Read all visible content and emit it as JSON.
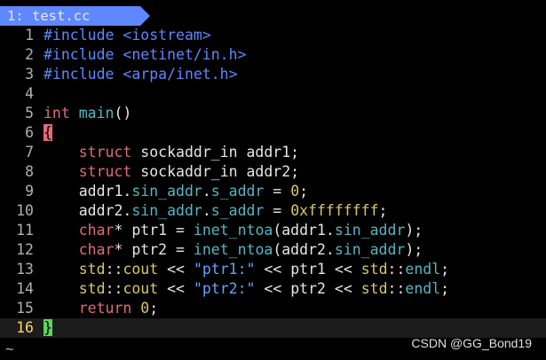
{
  "tab": {
    "label": "1: test.cc"
  },
  "lines": [
    {
      "num": "1",
      "code": [
        {
          "t": "#include ",
          "c": "pp"
        },
        {
          "t": "<iostream>",
          "c": "pp"
        }
      ]
    },
    {
      "num": "2",
      "code": [
        {
          "t": "#include ",
          "c": "pp"
        },
        {
          "t": "<netinet/in.h>",
          "c": "pp"
        }
      ]
    },
    {
      "num": "3",
      "code": [
        {
          "t": "#include ",
          "c": "pp"
        },
        {
          "t": "<arpa/inet.h>",
          "c": "pp"
        }
      ]
    },
    {
      "num": "4",
      "code": []
    },
    {
      "num": "5",
      "code": [
        {
          "t": "int",
          "c": "ty"
        },
        {
          "t": " ",
          "c": "plain"
        },
        {
          "t": "main",
          "c": "fn"
        },
        {
          "t": "()",
          "c": "plain"
        }
      ]
    },
    {
      "num": "6",
      "code": [
        {
          "t": "{",
          "c": "bracehl"
        }
      ]
    },
    {
      "num": "7",
      "code": [
        {
          "t": "    ",
          "c": "plain"
        },
        {
          "t": "struct",
          "c": "kw"
        },
        {
          "t": " sockaddr_in addr1;",
          "c": "plain"
        }
      ]
    },
    {
      "num": "8",
      "code": [
        {
          "t": "    ",
          "c": "plain"
        },
        {
          "t": "struct",
          "c": "kw"
        },
        {
          "t": " sockaddr_in addr2;",
          "c": "plain"
        }
      ]
    },
    {
      "num": "9",
      "code": [
        {
          "t": "    addr1.",
          "c": "plain"
        },
        {
          "t": "sin_addr",
          "c": "fn"
        },
        {
          "t": ".",
          "c": "plain"
        },
        {
          "t": "s_addr",
          "c": "fn"
        },
        {
          "t": " = ",
          "c": "plain"
        },
        {
          "t": "0",
          "c": "num"
        },
        {
          "t": ";",
          "c": "plain"
        }
      ]
    },
    {
      "num": "10",
      "code": [
        {
          "t": "    addr2.",
          "c": "plain"
        },
        {
          "t": "sin_addr",
          "c": "fn"
        },
        {
          "t": ".",
          "c": "plain"
        },
        {
          "t": "s_addr",
          "c": "fn"
        },
        {
          "t": " = ",
          "c": "plain"
        },
        {
          "t": "0xffffffff",
          "c": "num"
        },
        {
          "t": ";",
          "c": "plain"
        }
      ]
    },
    {
      "num": "11",
      "code": [
        {
          "t": "    ",
          "c": "plain"
        },
        {
          "t": "char",
          "c": "ty"
        },
        {
          "t": "* ptr1 = ",
          "c": "plain"
        },
        {
          "t": "inet_ntoa",
          "c": "fn"
        },
        {
          "t": "(addr1.",
          "c": "plain"
        },
        {
          "t": "sin_addr",
          "c": "fn"
        },
        {
          "t": ");",
          "c": "plain"
        }
      ]
    },
    {
      "num": "12",
      "code": [
        {
          "t": "    ",
          "c": "plain"
        },
        {
          "t": "char",
          "c": "ty"
        },
        {
          "t": "* ptr2 = ",
          "c": "plain"
        },
        {
          "t": "inet_ntoa",
          "c": "fn"
        },
        {
          "t": "(addr2.",
          "c": "plain"
        },
        {
          "t": "sin_addr",
          "c": "fn"
        },
        {
          "t": ");",
          "c": "plain"
        }
      ]
    },
    {
      "num": "13",
      "code": [
        {
          "t": "    ",
          "c": "plain"
        },
        {
          "t": "std",
          "c": "num"
        },
        {
          "t": "::",
          "c": "plain"
        },
        {
          "t": "cout",
          "c": "num"
        },
        {
          "t": " << ",
          "c": "plain"
        },
        {
          "t": "\"ptr1:\"",
          "c": "str"
        },
        {
          "t": " << ptr1 << ",
          "c": "plain"
        },
        {
          "t": "std",
          "c": "num"
        },
        {
          "t": "::",
          "c": "plain"
        },
        {
          "t": "endl",
          "c": "fn"
        },
        {
          "t": ";",
          "c": "plain"
        }
      ]
    },
    {
      "num": "14",
      "code": [
        {
          "t": "    ",
          "c": "plain"
        },
        {
          "t": "std",
          "c": "num"
        },
        {
          "t": "::",
          "c": "plain"
        },
        {
          "t": "cout",
          "c": "num"
        },
        {
          "t": " << ",
          "c": "plain"
        },
        {
          "t": "\"ptr2:\"",
          "c": "str"
        },
        {
          "t": " << ptr2 << ",
          "c": "plain"
        },
        {
          "t": "std",
          "c": "num"
        },
        {
          "t": "::",
          "c": "plain"
        },
        {
          "t": "endl",
          "c": "fn"
        },
        {
          "t": ";",
          "c": "plain"
        }
      ]
    },
    {
      "num": "15",
      "code": [
        {
          "t": "    ",
          "c": "plain"
        },
        {
          "t": "return",
          "c": "kw"
        },
        {
          "t": " ",
          "c": "plain"
        },
        {
          "t": "0",
          "c": "num"
        },
        {
          "t": ";",
          "c": "plain"
        }
      ]
    },
    {
      "num": "16",
      "code": [
        {
          "t": "}",
          "c": "bracehl2"
        }
      ],
      "current": true
    }
  ],
  "tilde": "~",
  "watermark": "CSDN @GG_Bond19",
  "colors": {
    "tab_bg": "#5f87ff",
    "preprocessor": "#5f87ff",
    "keyword": "#e06c75",
    "function": "#56b6c2",
    "number": "#d7c96a",
    "string": "#5fa5ff",
    "cursor_brace": "#5cd65c"
  }
}
